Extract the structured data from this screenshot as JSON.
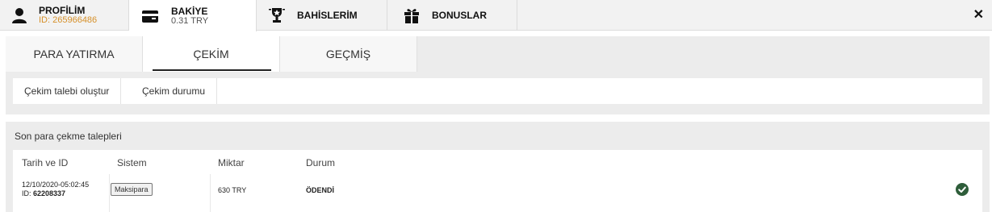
{
  "topbar": {
    "tabs": [
      {
        "label": "PROFİLİM",
        "sub": "ID: 265966486",
        "icon": "user-icon"
      },
      {
        "label": "BAKİYE",
        "sub": "0.31 TRY",
        "icon": "wallet-icon"
      },
      {
        "label": "BAHİSLERİM",
        "icon": "trophy-icon"
      },
      {
        "label": "BONUSLAR",
        "icon": "gift-icon"
      }
    ],
    "close": "✕"
  },
  "main_tabs": [
    "PARA YATIRMA",
    "ÇEKİM",
    "GEÇMİŞ"
  ],
  "sub_tabs": [
    "Çekim talebi oluştur",
    "Çekim durumu"
  ],
  "requests": {
    "title": "Son para çekme talepleri",
    "headers": [
      "Tarih ve ID",
      "Sistem",
      "Miktar",
      "Durum"
    ],
    "rows": [
      {
        "date": "12/10/2020-05:02:45",
        "id_prefix": "ID: ",
        "id": "62208337",
        "system": "Maksipara",
        "amount": "630 TRY",
        "status": "ÖDENDİ"
      }
    ]
  },
  "colors": {
    "accent_orange": "#d6902a",
    "success": "#2e5d3a"
  }
}
